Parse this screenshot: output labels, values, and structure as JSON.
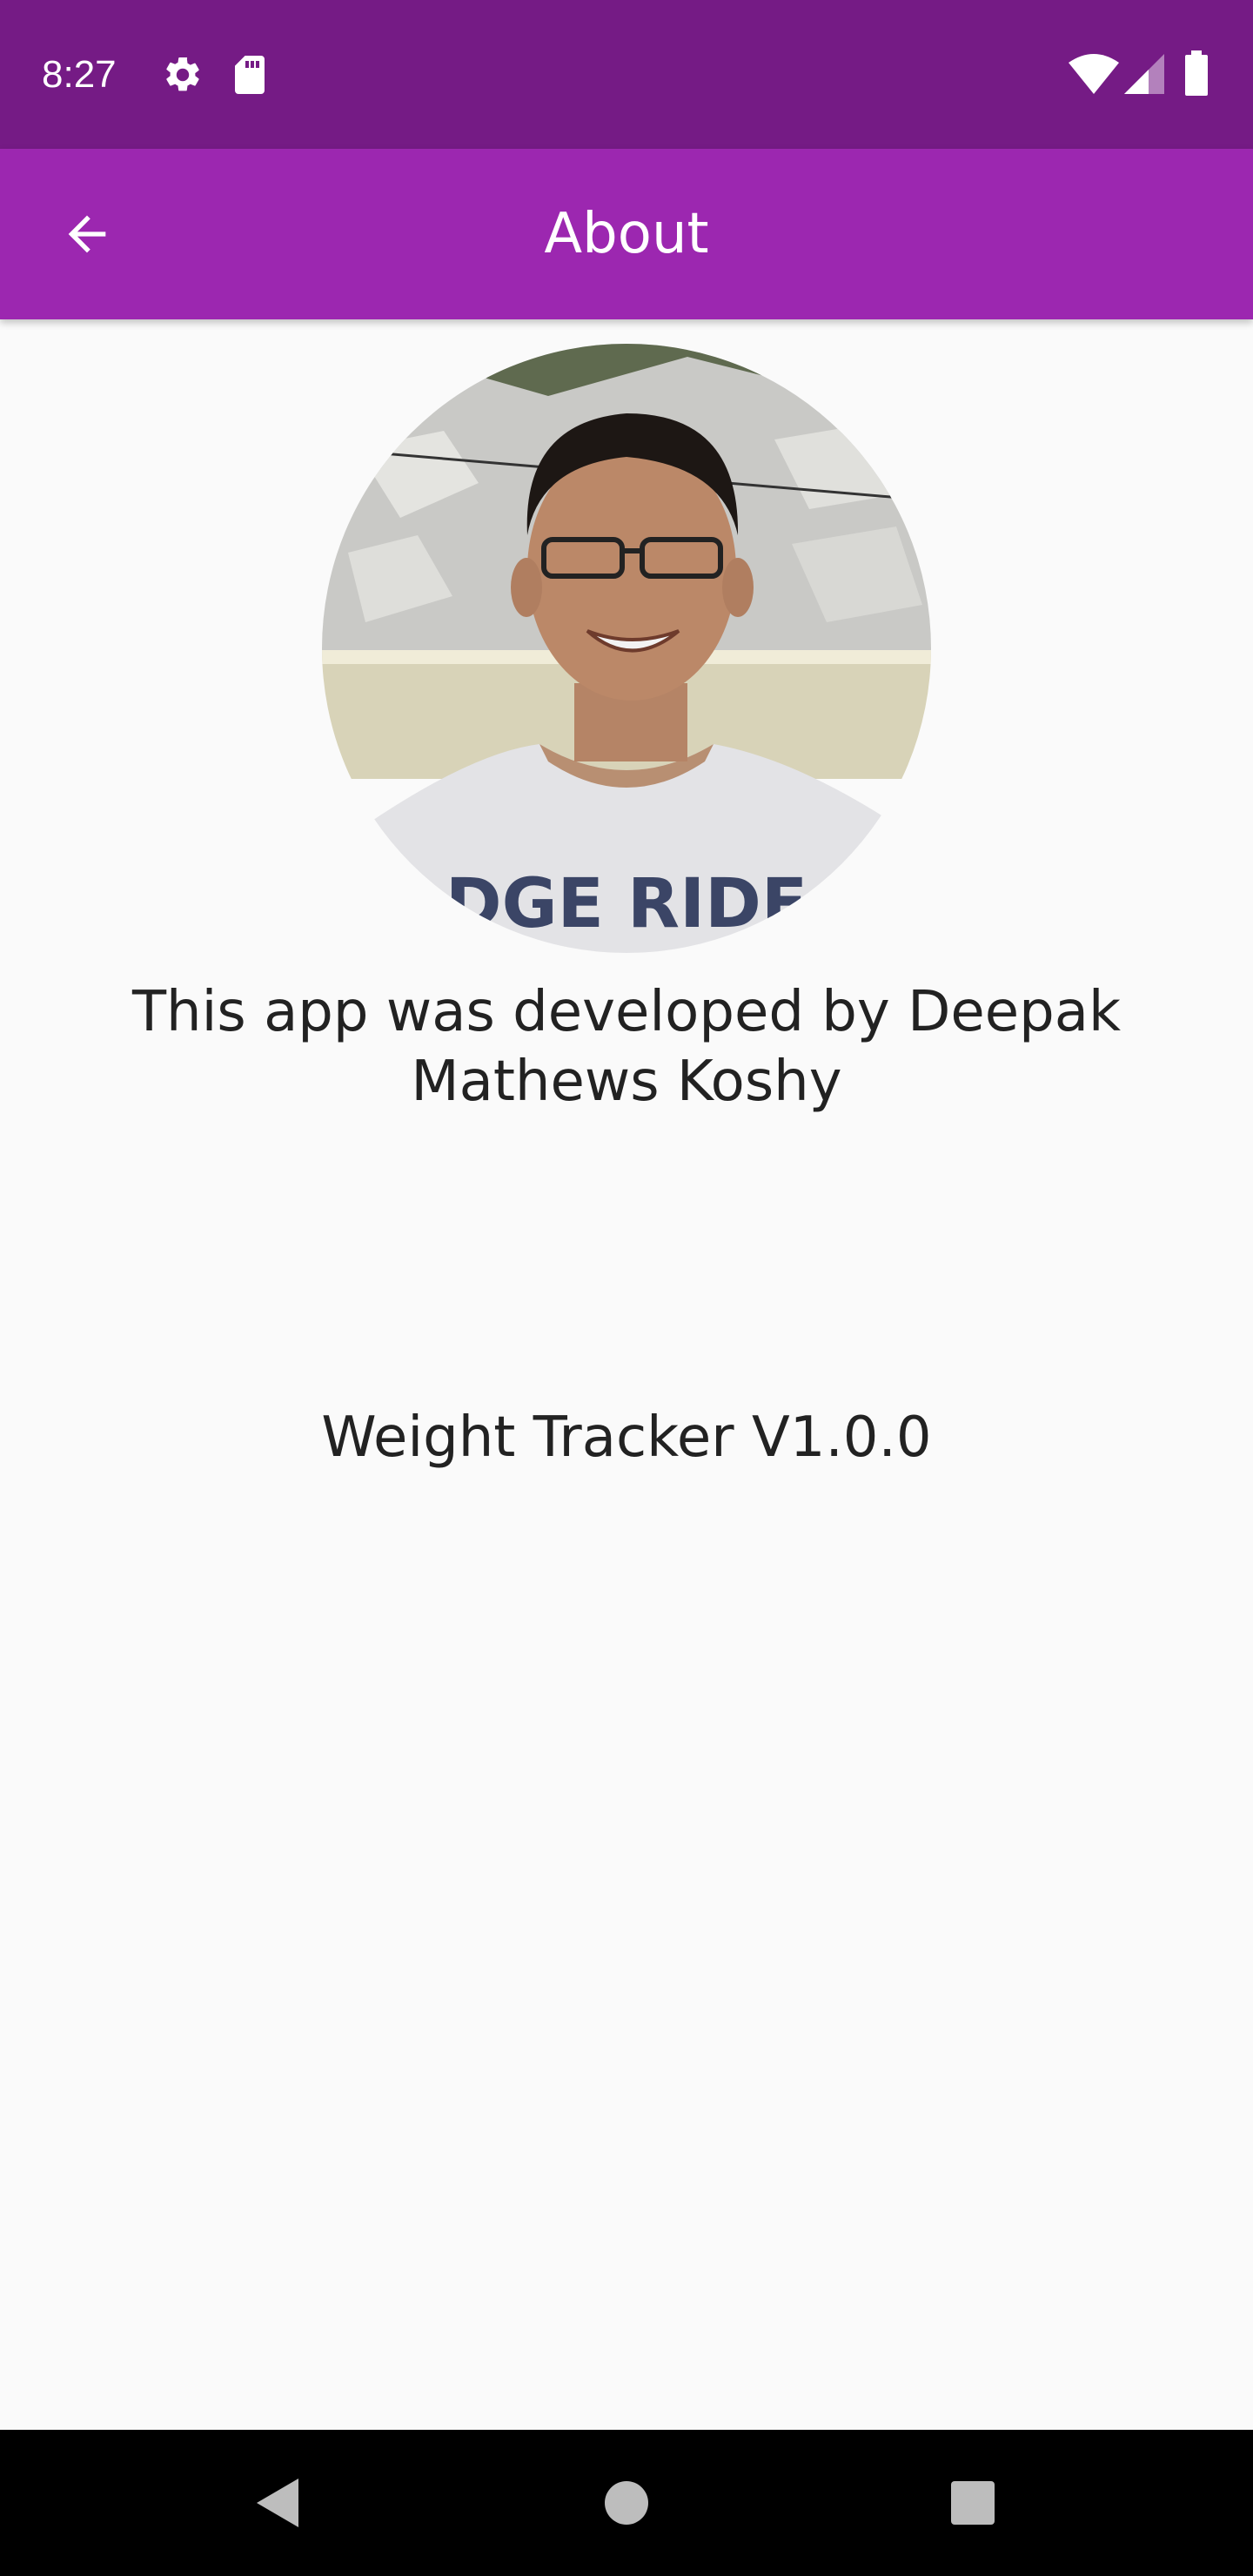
{
  "status_bar": {
    "time": "8:27",
    "icons": [
      "settings-gear-icon",
      "sd-card-icon",
      "wifi-icon",
      "cellular-signal-icon",
      "battery-icon"
    ],
    "background": "#751b85"
  },
  "app_bar": {
    "title": "About",
    "back_icon": "arrow-back-icon",
    "background": "#9c27b0"
  },
  "main": {
    "avatar": "developer-photo",
    "developer_text": "This app was developed by Deepak Mathews Koshy",
    "version_text": "Weight Tracker V1.0.0"
  },
  "nav_bar": {
    "icons": [
      "back-triangle-icon",
      "home-circle-icon",
      "recents-square-icon"
    ],
    "background": "#000000"
  }
}
